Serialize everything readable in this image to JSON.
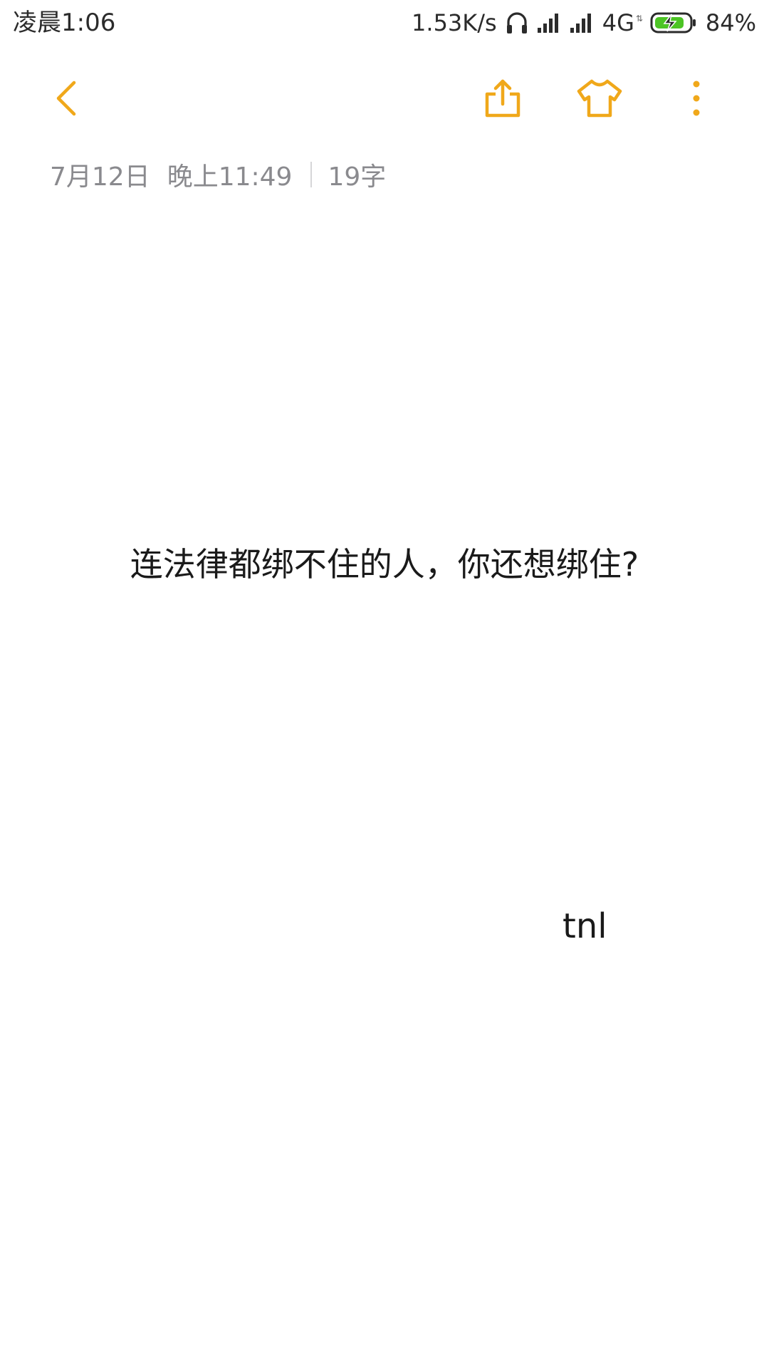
{
  "status_bar": {
    "time": "凌晨1:06",
    "net_speed": "1.53K/s",
    "network_type": "4G",
    "network_arrows": "⇅",
    "battery_percent": "84%",
    "icons": [
      "headphones-icon",
      "signal-icon",
      "signal-icon",
      "battery-charging-icon"
    ]
  },
  "toolbar": {
    "accent_color": "#f0a81a",
    "icons": [
      "back-arrow-icon",
      "share-icon",
      "theme-shirt-icon",
      "more-vertical-icon"
    ]
  },
  "meta": {
    "date": "7月12日",
    "time": "晚上11:49",
    "char_count": "19字"
  },
  "note": {
    "line1": "连法律都绑不住的人，你还想绑住?",
    "line2": "tnl"
  }
}
